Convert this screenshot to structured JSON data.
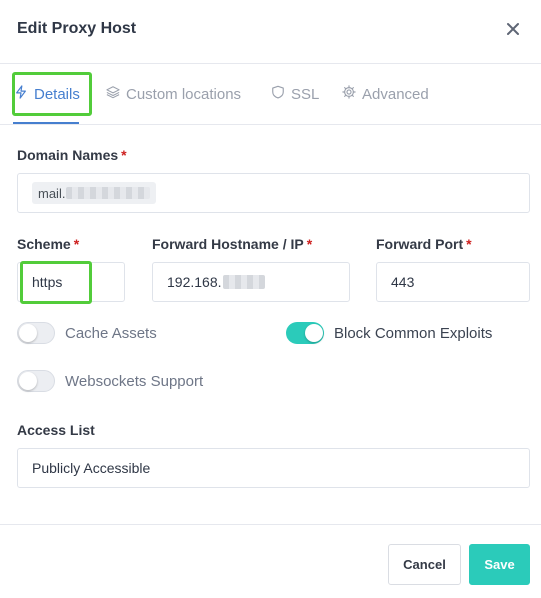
{
  "dialog": {
    "title": "Edit Proxy Host"
  },
  "icons": {
    "close": "close-icon",
    "details": "bolt-icon",
    "custom_locations": "layers-icon",
    "ssl": "shield-icon",
    "advanced": "gear-icon"
  },
  "tabs": [
    {
      "label": "Details",
      "active": true
    },
    {
      "label": "Custom locations",
      "active": false
    },
    {
      "label": "SSL",
      "active": false
    },
    {
      "label": "Advanced",
      "active": false
    }
  ],
  "form": {
    "domain_names": {
      "label": "Domain Names",
      "required_mark": "*",
      "value": "mail."
    },
    "scheme": {
      "label": "Scheme",
      "required_mark": "*",
      "value": "https"
    },
    "forward_host": {
      "label": "Forward Hostname / IP",
      "required_mark": "*",
      "value": "192.168."
    },
    "forward_port": {
      "label": "Forward Port",
      "required_mark": "*",
      "value": "443"
    },
    "cache_assets": {
      "label": "Cache Assets",
      "enabled": false
    },
    "block_exploits": {
      "label": "Block Common Exploits",
      "enabled": true
    },
    "websockets": {
      "label": "Websockets Support",
      "enabled": false
    },
    "access_list": {
      "label": "Access List",
      "value": "Publicly Accessible"
    }
  },
  "footer": {
    "cancel_label": "Cancel",
    "save_label": "Save"
  },
  "colors": {
    "accent": "#467fcf",
    "teal": "#2bcbba",
    "required": "#cd201f",
    "highlight": "#52cc3a"
  }
}
